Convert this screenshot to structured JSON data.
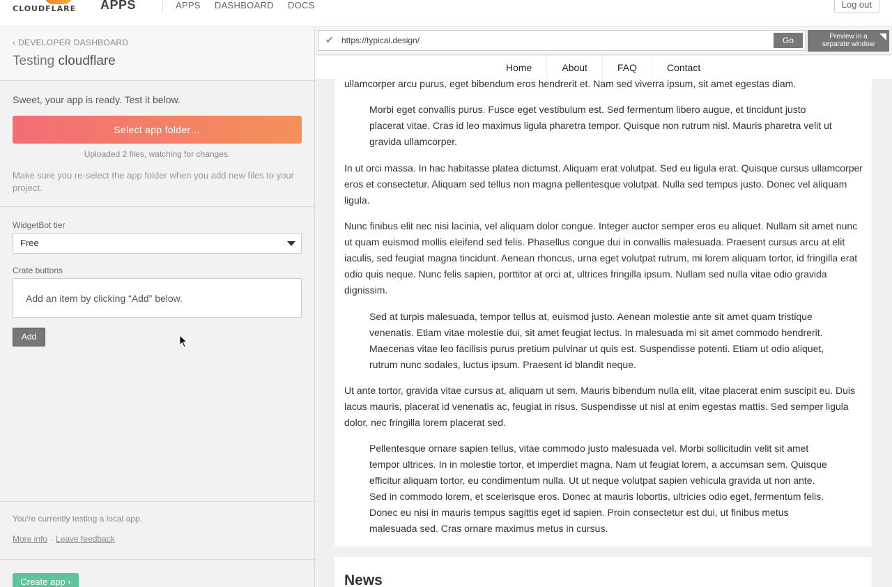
{
  "header": {
    "logo_text": "CLOUDFLARE",
    "app_title": "APPS",
    "nav": [
      "APPS",
      "DASHBOARD",
      "DOCS"
    ],
    "logout_label": "Log out"
  },
  "sidebar": {
    "back_link": "DEVELOPER DASHBOARD",
    "title_prefix": "Testing",
    "title_name": "cloudflare",
    "ready_text": "Sweet, your app is ready. Test it below.",
    "select_folder_label": "Select app folder…",
    "uploaded_text": "Uploaded 2 files, watching for changes.",
    "reselect_text": "Make sure you re-select the app folder when you add new files to your project.",
    "tier_label": "WidgetBot tier",
    "tier_value": "Free",
    "crate_label": "Crate buttons",
    "crate_empty_text": "Add an item by clicking “Add” below.",
    "add_label": "Add",
    "local_note": "You're currently testing a local app.",
    "more_info_label": "More info",
    "separator": "·",
    "feedback_label": "Leave feedback",
    "create_app_label": "Create app ›"
  },
  "preview": {
    "url": "https://typical.design/",
    "go_label": "Go",
    "preview_window_line1": "Preview in a",
    "preview_window_line2": "separate window",
    "site_nav": [
      "Home",
      "About",
      "FAQ",
      "Contact"
    ],
    "paragraphs": [
      "ullamcorper arcu purus, eget bibendum eros hendrerit et. Nam sed viverra ipsum, sit amet egestas diam.",
      "Morbi eget convallis purus. Fusce eget vestibulum est. Sed fermentum libero augue, et tincidunt justo placerat vitae. Cras id leo maximus ligula pharetra tempor. Quisque non rutrum nisl. Mauris pharetra velit ut gravida ullamcorper.",
      "In ut orci massa. In hac habitasse platea dictumst. Aliquam erat volutpat. Sed eu ligula erat. Quisque cursus ullamcorper eros et consectetur. Aliquam sed tellus non magna pellentesque volutpat. Nulla sed tempus justo. Donec vel aliquam ligula.",
      "Nunc finibus elit nec nisi lacinia, vel aliquam dolor congue. Integer auctor semper eros eu aliquet. Nullam sit amet nunc ut quam euismod mollis eleifend sed felis. Phasellus congue dui in convallis malesuada. Praesent cursus arcu at elit iaculis, sed feugiat magna tincidunt. Aenean rhoncus, urna eget volutpat rutrum, mi lorem aliquam tortor, id fringilla erat odio quis neque. Nunc felis sapien, porttitor at orci at, ultrices fringilla ipsum. Nullam sed nulla vitae odio gravida dignissim.",
      "Sed at turpis malesuada, tempor tellus at, euismod justo. Aenean molestie ante sit amet quam tristique venenatis. Etiam vitae molestie dui, sit amet feugiat lectus. In malesuada mi sit amet commodo hendrerit. Maecenas vitae leo facilisis purus pretium pulvinar ut quis est. Suspendisse potenti. Etiam ut odio aliquet, rutrum nunc sodales, luctus ipsum. Praesent id blandit neque.",
      "Ut ante tortor, gravida vitae cursus at, aliquam ut sem. Mauris bibendum nulla elit, vitae placerat enim suscipit eu. Duis lacus mauris, placerat id venenatis ac, feugiat in risus. Suspendisse ut nisl at enim egestas mattis. Sed semper ligula dolor, nec fringilla lorem placerat sed.",
      "Pellentesque ornare sapien tellus, vitae commodo justo malesuada vel. Morbi sollicitudin velit sit amet tempor ultrices. In in molestie tortor, et imperdiet magna. Nam ut feugiat lorem, a accumsan sem. Quisque efficitur aliquam tortor, eu condimentum nulla. Ut ut neque volutpat sapien vehicula gravida ut non ante. Sed in commodo lorem, et scelerisque eros. Donec at mauris lobortis, ultricies odio eget, fermentum felis. Donec eu nisi in mauris tempus sagittis eget id sapien. Proin consectetur est dui, ut finibus metus malesuada sed. Cras ornare maximus metus in cursus."
    ],
    "news_title": "News"
  },
  "colors": {
    "accent_gradient_start": "#f36d75",
    "accent_gradient_end": "#f4915a",
    "create_button": "#5ec49d"
  }
}
